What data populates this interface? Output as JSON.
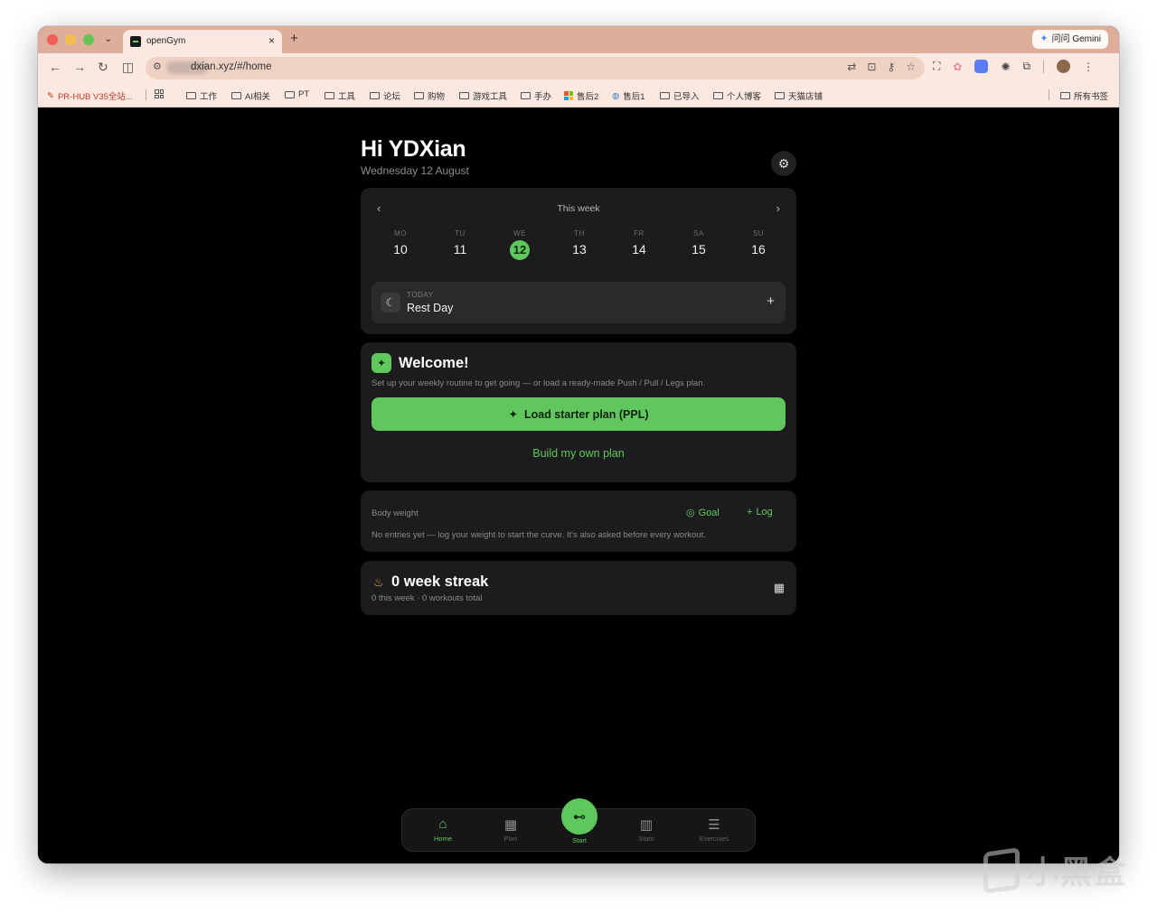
{
  "browser": {
    "tab_title": "openGym",
    "tab_close": "×",
    "new_tab": "+",
    "tab_menu": "⌄",
    "gemini_label": "问问 Gemini",
    "url": "dxian.xyz/#/home",
    "bookmarks": [
      {
        "label": "PR-HUB V35全站...",
        "type": "special"
      },
      {
        "label": "工作",
        "type": "folder"
      },
      {
        "label": "AI相关",
        "type": "folder"
      },
      {
        "label": "PT",
        "type": "folder"
      },
      {
        "label": "工具",
        "type": "folder"
      },
      {
        "label": "论坛",
        "type": "folder"
      },
      {
        "label": "购物",
        "type": "folder"
      },
      {
        "label": "游戏工具",
        "type": "folder"
      },
      {
        "label": "手办",
        "type": "folder"
      },
      {
        "label": "售后2",
        "type": "ms"
      },
      {
        "label": "售后1",
        "type": "globe"
      },
      {
        "label": "已导入",
        "type": "folder"
      },
      {
        "label": "个人博客",
        "type": "folder"
      },
      {
        "label": "天猫店铺",
        "type": "folder"
      }
    ],
    "all_bookmarks": "所有书签"
  },
  "header": {
    "greeting": "Hi YDXian",
    "date": "Wednesday 12 August"
  },
  "week": {
    "title": "This week",
    "prev": "‹",
    "next": "›",
    "days": [
      {
        "abbr": "MO",
        "num": "10"
      },
      {
        "abbr": "TU",
        "num": "11"
      },
      {
        "abbr": "WE",
        "num": "12"
      },
      {
        "abbr": "TH",
        "num": "13"
      },
      {
        "abbr": "FR",
        "num": "14"
      },
      {
        "abbr": "SA",
        "num": "15"
      },
      {
        "abbr": "SU",
        "num": "16"
      }
    ],
    "today_index": 2,
    "today_label": "TODAY",
    "today_value": "Rest Day",
    "add": "+"
  },
  "welcome": {
    "title": "Welcome!",
    "description": "Set up your weekly routine to get going — or load a ready-made Push / Pull / Legs plan.",
    "load_button": "Load starter plan (PPL)",
    "build_link": "Build my own plan"
  },
  "body_weight": {
    "title": "Body weight",
    "goal": "Goal",
    "log": "Log",
    "description": "No entries yet — log your weight to start the curve. It's also asked before every workout."
  },
  "streak": {
    "title": "0 week streak",
    "description": "0 this week · 0 workouts total"
  },
  "bottom_nav": {
    "items": [
      {
        "label": "Home",
        "icon": "home-icon"
      },
      {
        "label": "Plan",
        "icon": "calendar-icon"
      },
      {
        "label": "Start",
        "icon": "dumbbell-icon"
      },
      {
        "label": "Stats",
        "icon": "bar-chart-icon"
      },
      {
        "label": "Exercises",
        "icon": "list-icon"
      }
    ],
    "active": "Home"
  },
  "watermark": "小黑盒",
  "colors": {
    "accent": "#5fc85c",
    "background": "#000000",
    "card": "#1c1c1e",
    "browser_frame": "#dfae9a"
  }
}
